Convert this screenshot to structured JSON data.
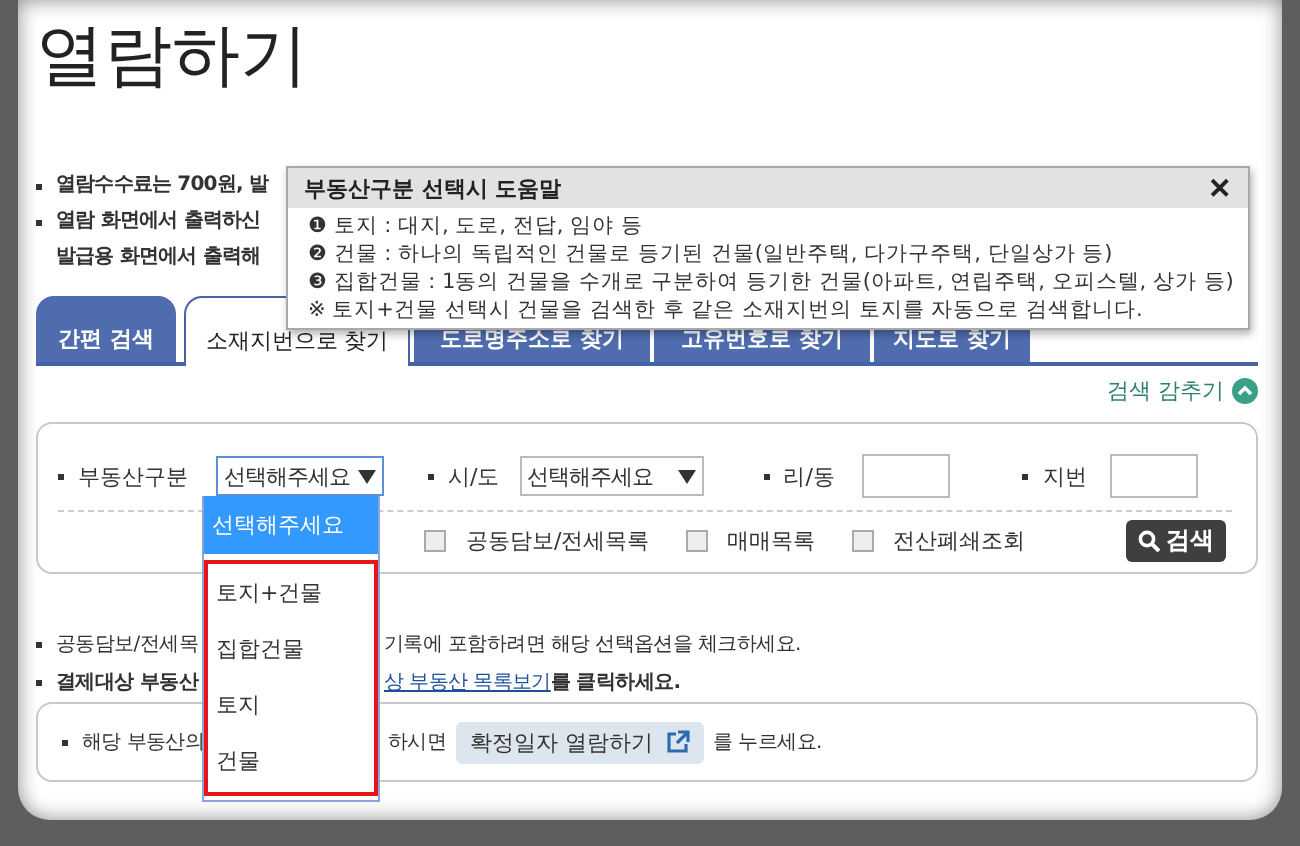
{
  "title": "열람하기",
  "notices": [
    "열람수수료는 700원, 발",
    "열람 화면에서 출력하신",
    "발급용 화면에서 출력해"
  ],
  "tooltip": {
    "title": "부동산구분 선택시 도움말",
    "close": "✕",
    "lines": [
      "❶ 토지 : 대지, 도로, 전답, 임야 등",
      "❷ 건물 : 하나의 독립적인 건물로 등기된 건물(일반주택, 다가구주택, 단일상가 등)",
      "❸ 집합건물 : 1동의 건물을 수개로 구분하여 등기한 건물(아파트, 연립주택, 오피스텔, 상가 등)",
      "※ 토지+건물 선택시 건물을 검색한 후 같은 소재지번의 토지를 자동으로 검색합니다."
    ]
  },
  "tabs": [
    {
      "label": "간편 검색",
      "selected": false
    },
    {
      "label": "소재지번으로 찾기",
      "selected": true
    },
    {
      "label": "도로명주소로 찾기",
      "selected": false
    },
    {
      "label": "고유번호로 찾기",
      "selected": false
    },
    {
      "label": "지도로 찾기",
      "selected": false
    }
  ],
  "toggle": {
    "label": "검색 감추기",
    "expanded": true
  },
  "search": {
    "fields": [
      {
        "kind": "select",
        "label": "부동산구분",
        "value": "선택해주세요",
        "open": true
      },
      {
        "kind": "select",
        "label": "시/도",
        "value": "선택해주세요",
        "open": false
      },
      {
        "kind": "input",
        "label": "리/동"
      },
      {
        "kind": "input",
        "label": "지번"
      }
    ],
    "options": [
      {
        "label": "공동담보/전세목록",
        "checked": false
      },
      {
        "label": "매매목록",
        "checked": false
      },
      {
        "label": "전산폐쇄조회",
        "checked": false
      }
    ],
    "button": "검색"
  },
  "dropdown": {
    "items": [
      {
        "label": "선택해주세요",
        "selected": true,
        "marked": false
      },
      {
        "label": "토지+건물",
        "selected": false,
        "marked": true
      },
      {
        "label": "집합건물",
        "selected": false,
        "marked": true
      },
      {
        "label": "토지",
        "selected": false,
        "marked": true
      },
      {
        "label": "건물",
        "selected": false,
        "marked": true
      }
    ]
  },
  "notes": [
    {
      "bold": false,
      "segments": [
        {
          "text": "공동담보/전세목",
          "link": false
        },
        {
          "text": "기록에 포함하려면 해당 선택옵션을 체크하세요.",
          "link": false
        }
      ]
    },
    {
      "bold": true,
      "segments": [
        {
          "text": "결제대상 부동산",
          "link": false
        },
        {
          "text": "상 부동산 목록보기",
          "link": true
        },
        {
          "text": "를 클릭하세요.",
          "link": false
        }
      ]
    }
  ],
  "confirm": {
    "before": "해당 부동산의",
    "after_gap": "하시면",
    "button": "확정일자 열람하기",
    "after": "를 누르세요."
  }
}
